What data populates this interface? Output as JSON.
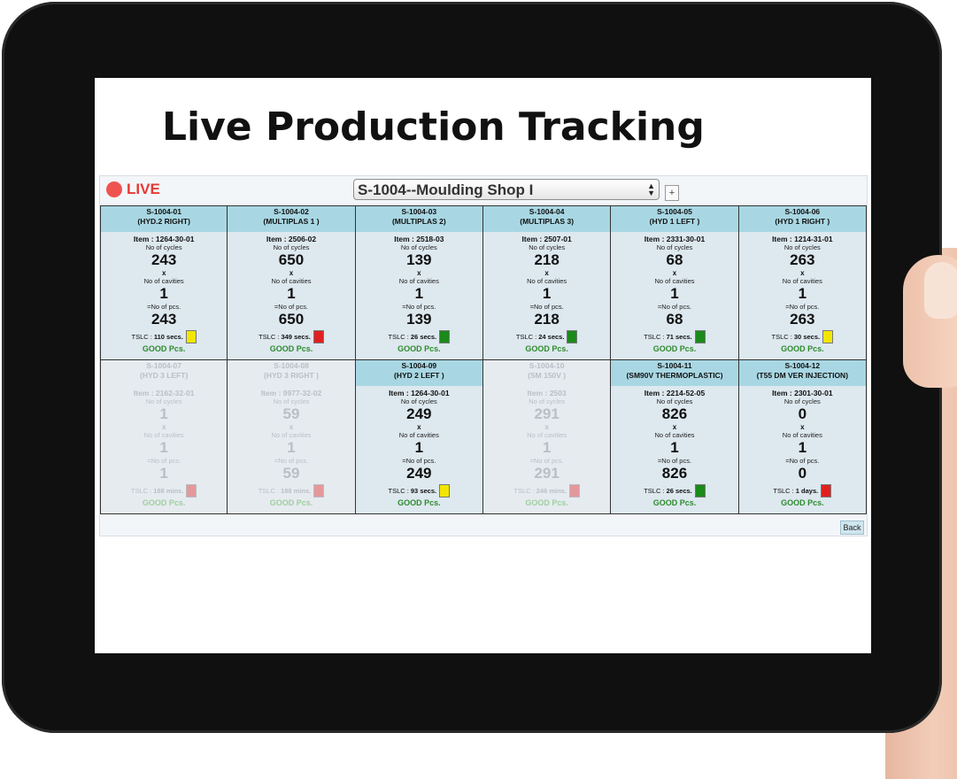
{
  "page_title": "Live Production Tracking",
  "live_label": "LIVE",
  "shop_select": {
    "value": "S-1004--Moulding Shop I"
  },
  "plus_label": "+",
  "back_label": "Back",
  "labels": {
    "cycles": "No of cycles",
    "times": "x",
    "cavities": "No of cavities",
    "pcs": "=No of pcs.",
    "good": "GOOD Pcs."
  },
  "machines": [
    {
      "id": "S-1004-01",
      "name": "(HYD.2 RIGHT)",
      "item": "Item : 1264-30-01",
      "cycles": "243",
      "cavities": "1",
      "pcs": "243",
      "tslc_label": "TSLC :",
      "tslc_value": "110 secs.",
      "status_color": "#f2e600",
      "active": true
    },
    {
      "id": "S-1004-02",
      "name": "(MULTIPLAS 1 )",
      "item": "Item : 2506-02",
      "cycles": "650",
      "cavities": "1",
      "pcs": "650",
      "tslc_label": "TSLC :",
      "tslc_value": "349 secs.",
      "status_color": "#e02020",
      "active": true
    },
    {
      "id": "S-1004-03",
      "name": "(MULTIPLAS 2)",
      "item": "Item : 2518-03",
      "cycles": "139",
      "cavities": "1",
      "pcs": "139",
      "tslc_label": "TSLC :",
      "tslc_value": "26 secs.",
      "status_color": "#1a8a1a",
      "active": true
    },
    {
      "id": "S-1004-04",
      "name": "(MULTIPLAS 3)",
      "item": "Item : 2507-01",
      "cycles": "218",
      "cavities": "1",
      "pcs": "218",
      "tslc_label": "TSLC :",
      "tslc_value": "24 secs.",
      "status_color": "#1a8a1a",
      "active": true
    },
    {
      "id": "S-1004-05",
      "name": "(HYD 1 LEFT )",
      "item": "Item : 2331-30-01",
      "cycles": "68",
      "cavities": "1",
      "pcs": "68",
      "tslc_label": "TSLC :",
      "tslc_value": "71 secs.",
      "status_color": "#1a8a1a",
      "active": true
    },
    {
      "id": "S-1004-06",
      "name": "(HYD 1 RIGHT )",
      "item": "Item : 1214-31-01",
      "cycles": "263",
      "cavities": "1",
      "pcs": "263",
      "tslc_label": "TSLC :",
      "tslc_value": "30 secs.",
      "status_color": "#f2e600",
      "active": true
    },
    {
      "id": "S-1004-07",
      "name": "(HYD 3 LEFT)",
      "item": "Item : 2162-32-01",
      "cycles": "1",
      "cavities": "1",
      "pcs": "1",
      "tslc_label": "TSLC :",
      "tslc_value": "188 mins.",
      "status_color": "#e02020",
      "active": false
    },
    {
      "id": "S-1004-08",
      "name": "(HYD 3 RIGHT )",
      "item": "Item : 9977-32-02",
      "cycles": "59",
      "cavities": "1",
      "pcs": "59",
      "tslc_label": "TSLC :",
      "tslc_value": "188 mins.",
      "status_color": "#e02020",
      "active": false
    },
    {
      "id": "S-1004-09",
      "name": "(HYD 2 LEFT )",
      "item": "Item : 1264-30-01",
      "cycles": "249",
      "cavities": "1",
      "pcs": "249",
      "tslc_label": "TSLC :",
      "tslc_value": "93 secs.",
      "status_color": "#f2e600",
      "active": true
    },
    {
      "id": "S-1004-10",
      "name": "(SM 150V )",
      "item": "Item : 2503",
      "cycles": "291",
      "cavities": "1",
      "pcs": "291",
      "tslc_label": "TSLC :",
      "tslc_value": "246 mins.",
      "status_color": "#e02020",
      "active": false
    },
    {
      "id": "S-1004-11",
      "name": "(SM90V THERMOPLASTIC)",
      "item": "Item : 2214-52-05",
      "cycles": "826",
      "cavities": "1",
      "pcs": "826",
      "tslc_label": "TSLC :",
      "tslc_value": "26 secs.",
      "status_color": "#1a8a1a",
      "active": true
    },
    {
      "id": "S-1004-12",
      "name": "(T55 DM VER INJECTION)",
      "item": "Item : 2301-30-01",
      "cycles": "0",
      "cavities": "1",
      "pcs": "0",
      "tslc_label": "TSLC :",
      "tslc_value": "1 days.",
      "status_color": "#e02020",
      "active": true
    }
  ]
}
